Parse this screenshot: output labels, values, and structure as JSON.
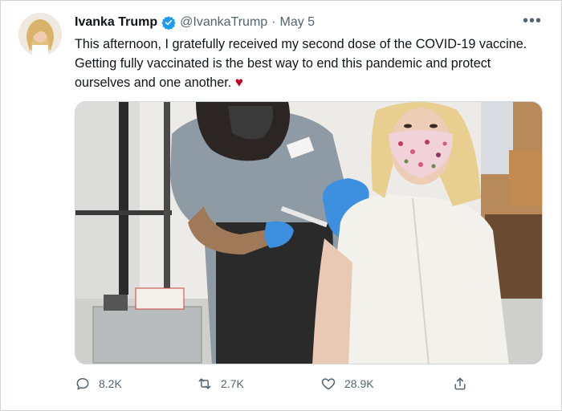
{
  "tweet": {
    "author_name": "Ivanka Trump",
    "handle": "@IvankaTrump",
    "separator": "·",
    "date": "May 5",
    "more_glyph": "•••",
    "text": "This afternoon, I gratefully received my second dose of the COVID-19 vaccine. Getting fully vaccinated is the best way to end this pandemic and protect ourselves and one another.",
    "heart_glyph": "♥",
    "verified_color": "#1d9bf0"
  },
  "actions": {
    "replies": "8.2K",
    "retweets": "2.7K",
    "likes": "28.9K"
  },
  "icons": {
    "avatar": "profile-photo",
    "verified": "verified-badge-icon",
    "reply": "reply-bubble-icon",
    "retweet": "retweet-icon",
    "like": "heart-outline-icon",
    "share": "share-upload-icon"
  }
}
